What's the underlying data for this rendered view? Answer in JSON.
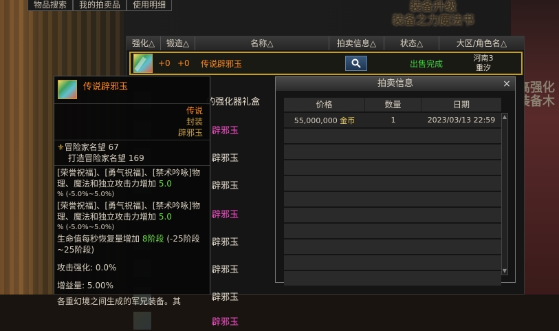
{
  "top_tabs": [
    "物品搜索",
    "我的拍卖品",
    "使用明细"
  ],
  "banner": {
    "line1": "装备升级",
    "line2": "装备之力魔法书"
  },
  "right_bg_text": "高强化 装备木",
  "table": {
    "headers": [
      "强化△",
      "锻造△",
      "名称△",
      "拍卖信息△",
      "状态△",
      "大区/角色名△"
    ],
    "selected_row": {
      "enhance": "+0",
      "forge": "+0",
      "name": "传说辟邪玉",
      "status": "出售完成",
      "region": "河南3",
      "character": "重汐"
    },
    "other_rows": [
      {
        "name": "的强化器礼盒",
        "color": "#e8e0d0"
      },
      {
        "name": "辟邪玉",
        "color": "#ff50d0"
      },
      {
        "name": "辟邪玉",
        "color": "#e8e0d0"
      },
      {
        "name": "辟邪玉",
        "color": "#e8e0d0"
      },
      {
        "name": "辟邪玉",
        "color": "#ff50d0"
      },
      {
        "name": "辟邪玉",
        "color": "#e8e0d0"
      },
      {
        "name": "辟邪玉",
        "color": "#e8e0d0"
      },
      {
        "name": "辟邪玉",
        "color": "#e8e0d0"
      },
      {
        "name": "辟邪玉",
        "color": "#ff50d0"
      }
    ]
  },
  "tooltip": {
    "title": "传说辟邪玉",
    "rarity": "传说",
    "seal": "封装",
    "type": "辟邪玉",
    "fame_label": "冒险家名望",
    "fame_value": "67",
    "forge_fame_label": "打造冒险家名望",
    "forge_fame_value": "169",
    "effect1_text": "[荣誉祝福]、[勇气祝福]、[禁术吟咏]物理、魔法和独立攻击力增加",
    "effect1_value": "5.0",
    "effect1_range": "% (-5.0%~5.0%)",
    "effect2_text": "[荣誉祝福]、[勇气祝福]、[禁术吟咏]物理、魔法和独立攻击力增加",
    "effect2_value": "5.0",
    "effect2_range": "% (-5.0%~5.0%)",
    "effect3_text": "生命值每秒恢复量增加",
    "effect3_value": "8阶段",
    "effect3_range": "(-25阶段~25阶段)",
    "atk_enhance_label": "攻击强化:",
    "atk_enhance_value": "0.0%",
    "gain_label": "增益量:",
    "gain_value": "5.00%",
    "footer": "各重幻境之间生成的军兄装备。其"
  },
  "popup": {
    "title": "拍卖信息",
    "close": "×",
    "headers": [
      "价格",
      "数量",
      "日期"
    ],
    "rows": [
      {
        "price": "55,000,000",
        "currency": "金币",
        "qty": "1",
        "date": "2023/03/13 22:59"
      }
    ],
    "empty_rows": 10
  },
  "icons": [
    "search-icon",
    "close-icon",
    "fame-icon",
    "item-jade-icon",
    "scroll-up-icon",
    "scroll-down-icon"
  ]
}
